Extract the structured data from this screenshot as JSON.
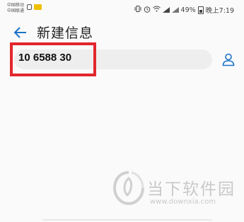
{
  "status_bar": {
    "carrier_1": "中国移动",
    "carrier_2": "中国联通",
    "battery": "49%",
    "time": "晚上7:19"
  },
  "header": {
    "title": "新建信息"
  },
  "recipient": {
    "value": "10 6588 30"
  },
  "watermark": {
    "name": "当下软件园",
    "url": "www.downxia.com"
  },
  "colors": {
    "highlight": "#e3262d",
    "accent": "#1a73c8"
  }
}
